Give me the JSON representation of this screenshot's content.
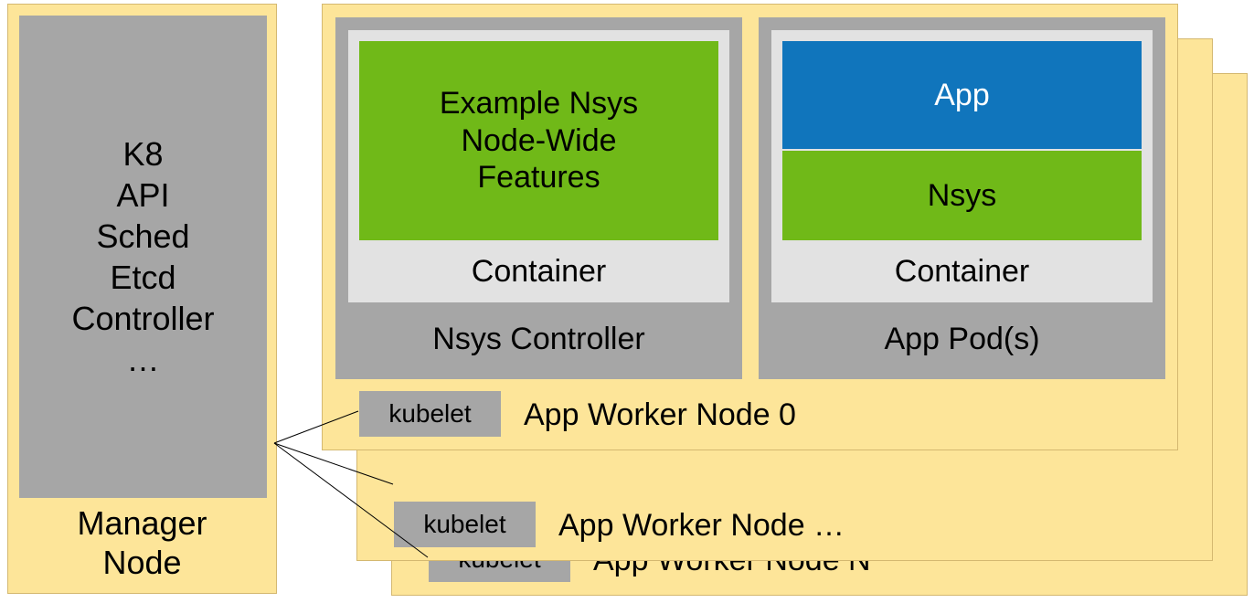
{
  "manager": {
    "label": "Manager\nNode",
    "components": [
      "K8",
      "API",
      "Sched",
      "Etcd",
      "Controller",
      "…"
    ]
  },
  "workers": [
    {
      "kubelet": "kubelet",
      "label": "App Worker Node 0"
    },
    {
      "kubelet": "kubelet",
      "label": "App Worker Node …"
    },
    {
      "kubelet": "kubelet",
      "label": "App Worker Node N"
    }
  ],
  "pods": {
    "nsys_controller": {
      "label": "Nsys Controller",
      "container_label": "Container",
      "feature_box": "Example Nsys\nNode-Wide\nFeatures"
    },
    "app_pod": {
      "label": "App Pod(s)",
      "container_label": "Container",
      "app_label": "App",
      "nsys_label": "Nsys"
    }
  },
  "colors": {
    "panel_bg": "#fde599",
    "gray": "#a6a6a6",
    "light_gray": "#e2e2e2",
    "green": "#70b918",
    "blue": "#1075bc"
  }
}
